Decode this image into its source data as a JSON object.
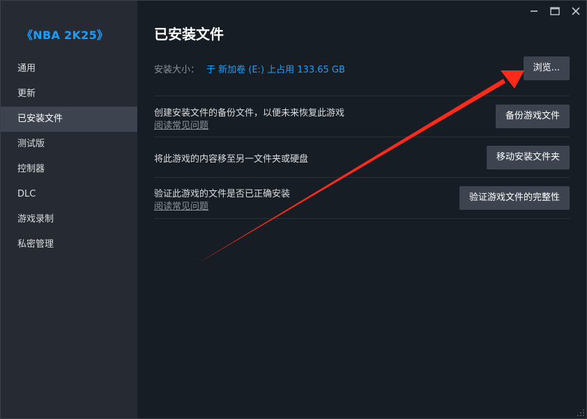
{
  "sidebar": {
    "game_title": "《NBA 2K25》",
    "items": [
      {
        "label": "通用"
      },
      {
        "label": "更新"
      },
      {
        "label": "已安装文件"
      },
      {
        "label": "测试版"
      },
      {
        "label": "控制器"
      },
      {
        "label": "DLC"
      },
      {
        "label": "游戏录制"
      },
      {
        "label": "私密管理"
      }
    ],
    "active_index": 2
  },
  "main": {
    "title": "已安装文件",
    "install_size_label": "安装大小：",
    "install_size_value": "于 新加卷 (E:) 上占用 133.65 GB",
    "browse_button": "浏览...",
    "sections": [
      {
        "text": "创建安装文件的备份文件，以便未来恢复此游戏",
        "link": "阅读常见问题",
        "button": "备份游戏文件"
      },
      {
        "text": "将此游戏的内容移至另一文件夹或硬盘",
        "button": "移动安装文件夹"
      },
      {
        "text": "验证此游戏的文件是否已正确安装",
        "link": "阅读常见问题",
        "button": "验证游戏文件的完整性"
      }
    ]
  },
  "colors": {
    "accent": "#1a9fff",
    "arrow": "#ff2a1a"
  }
}
